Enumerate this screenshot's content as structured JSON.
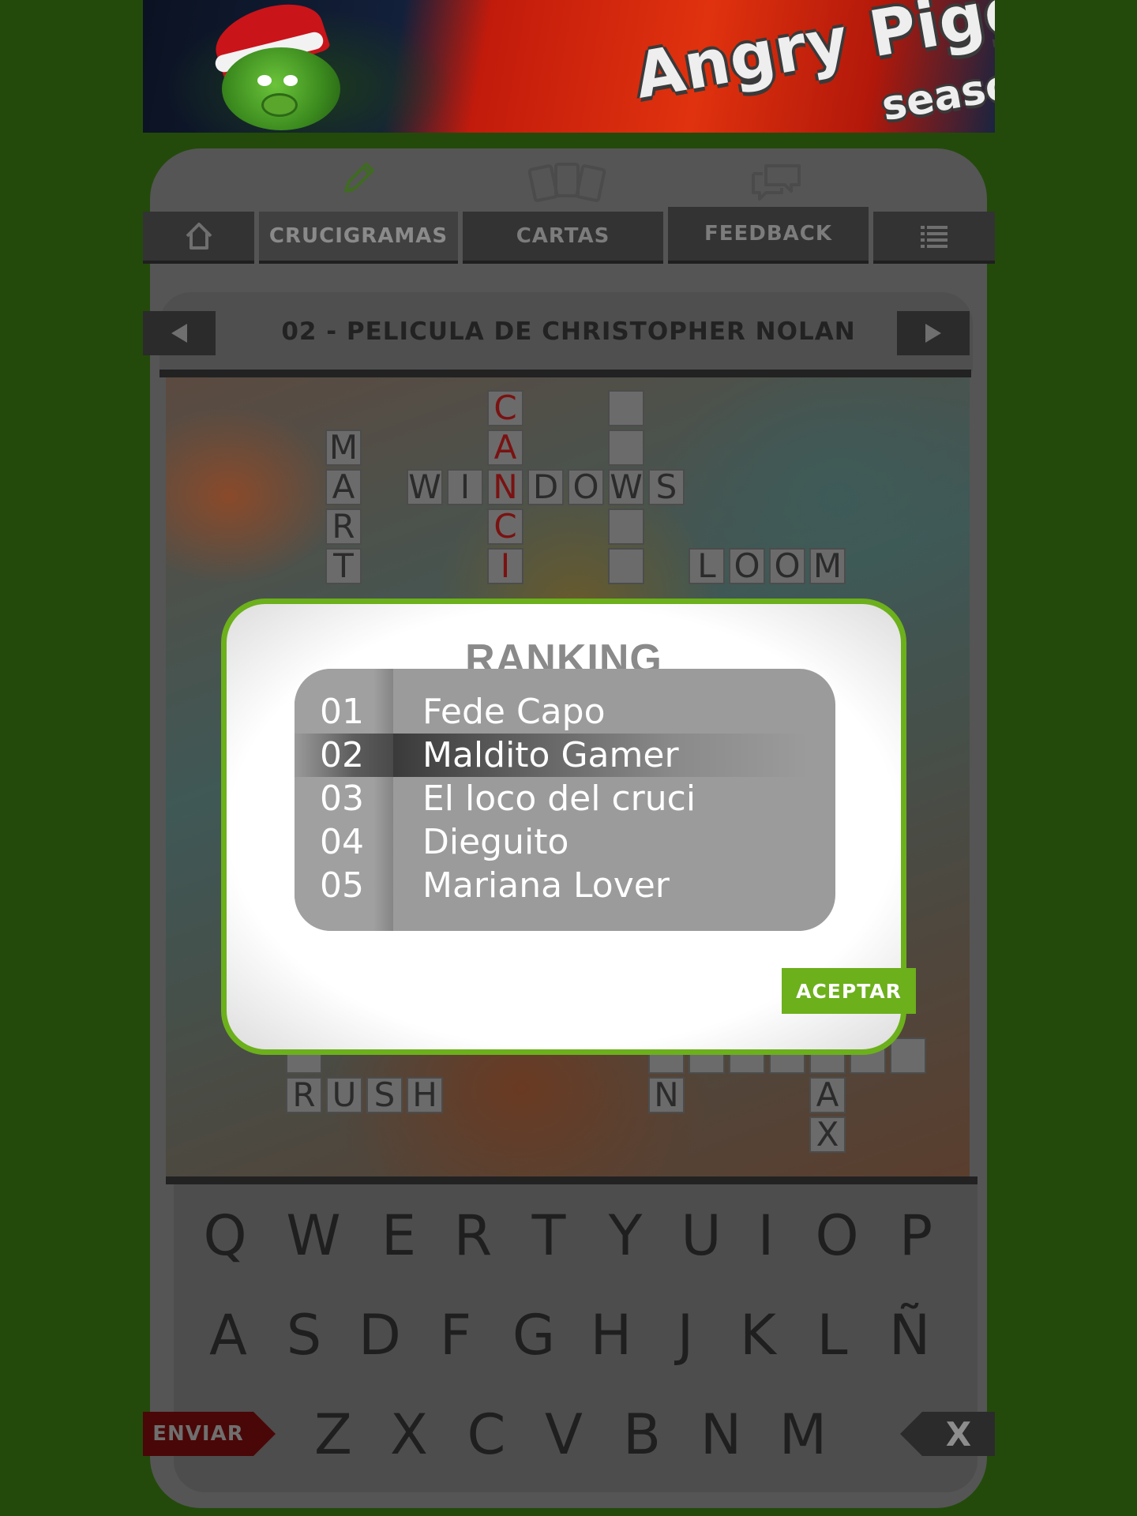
{
  "banner": {
    "title": "Angry Piggy",
    "subtitle": "season"
  },
  "nav": {
    "home_icon": "home-icon",
    "items": [
      {
        "label": "CRUCIGRAMAS",
        "icon": "pencil-icon",
        "active": true
      },
      {
        "label": "CARTAS",
        "icon": "cards-icon",
        "active": false
      },
      {
        "label": "FEEDBACK",
        "icon": "chat-icon",
        "active": false
      }
    ],
    "menu_icon": "menu-icon"
  },
  "crossword": {
    "title": "02 - PELICULA DE CHRISTOPHER NOLAN",
    "prev_icon": "arrow-left-icon",
    "next_icon": "arrow-right-icon",
    "cells_visible": [
      "M",
      "A",
      "R",
      "T",
      "C",
      "A",
      "N",
      "C",
      "I",
      "W",
      "I",
      "N",
      "D",
      "O",
      "W",
      "S",
      "L",
      "O",
      "O",
      "M",
      "R",
      "U",
      "S",
      "H",
      "N",
      "A",
      "X"
    ],
    "highlight_color": "#7a1212"
  },
  "keyboard": {
    "row1": [
      "Q",
      "W",
      "E",
      "R",
      "T",
      "Y",
      "U",
      "I",
      "O",
      "P"
    ],
    "row2": [
      "A",
      "S",
      "D",
      "F",
      "G",
      "H",
      "J",
      "K",
      "L",
      "Ñ"
    ],
    "row3": [
      "Z",
      "X",
      "C",
      "V",
      "B",
      "N",
      "M"
    ],
    "send_label": "ENVIAR",
    "delete_label": "X"
  },
  "modal": {
    "title": "RANKING",
    "accept_label": "ACEPTAR",
    "accent_color": "#6cb01c",
    "rows": [
      {
        "pos": "01",
        "name": "Fede Capo"
      },
      {
        "pos": "02",
        "name": "Maldito Gamer"
      },
      {
        "pos": "03",
        "name": "El loco del cruci"
      },
      {
        "pos": "04",
        "name": "Dieguito"
      },
      {
        "pos": "05",
        "name": "Mariana Lover"
      }
    ],
    "highlighted_index": 1
  }
}
